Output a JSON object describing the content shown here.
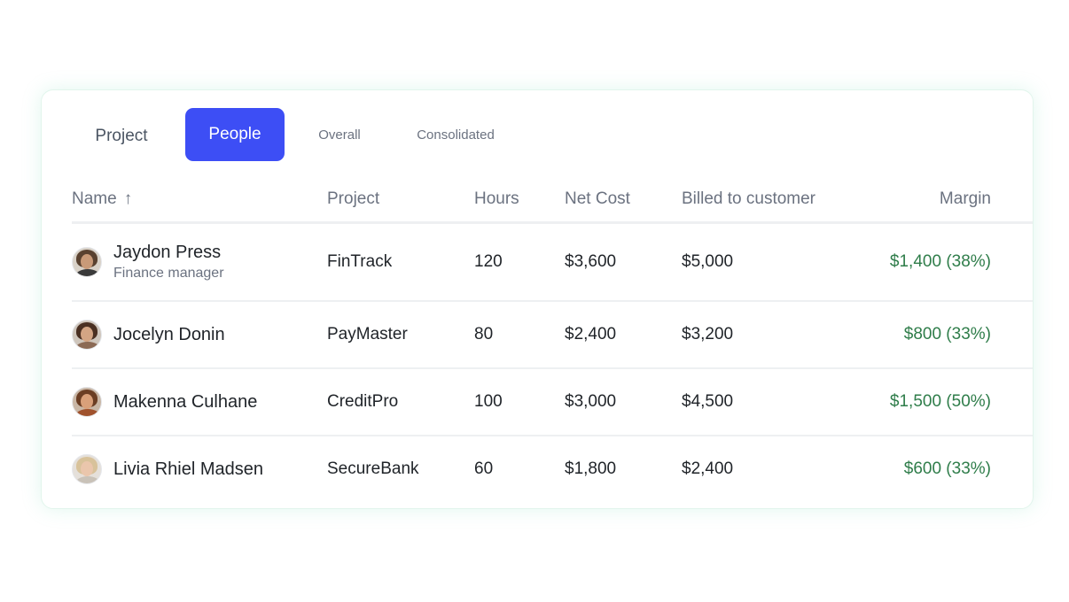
{
  "tabs": {
    "project": "Project",
    "people": "People",
    "overall": "Overall",
    "consolidated": "Consolidated",
    "active": "People",
    "active_color": "#3d4ef5"
  },
  "table": {
    "headers": {
      "name": "Name",
      "project": "Project",
      "hours": "Hours",
      "net_cost": "Net Cost",
      "billed": "Billed to customer",
      "margin": "Margin"
    },
    "sort": {
      "column": "Name",
      "direction": "ascending",
      "icon": "arrow-up-icon",
      "glyph": "↑"
    },
    "rows": [
      {
        "name": "Jaydon Press",
        "role": "Finance manager",
        "project": "FinTrack",
        "hours": "120",
        "net_cost": "$3,600",
        "billed": "$5,000",
        "margin": "$1,400 (38%)",
        "avatar": "avatar-icon"
      },
      {
        "name": "Jocelyn Donin",
        "role": "",
        "project": "PayMaster",
        "hours": "80",
        "net_cost": "$2,400",
        "billed": "$3,200",
        "margin": "$800 (33%)",
        "avatar": "avatar-icon"
      },
      {
        "name": "Makenna Culhane",
        "role": "",
        "project": "CreditPro",
        "hours": "100",
        "net_cost": "$3,000",
        "billed": "$4,500",
        "margin": "$1,500 (50%)",
        "avatar": "avatar-icon"
      },
      {
        "name": "Livia Rhiel Madsen",
        "role": "",
        "project": "SecureBank",
        "hours": "60",
        "net_cost": "$1,800",
        "billed": "$2,400",
        "margin": "$600 (33%)",
        "avatar": "avatar-icon"
      }
    ]
  },
  "colors": {
    "margin_positive": "#2f7d4a",
    "card_glow": "#e2f5ec"
  }
}
